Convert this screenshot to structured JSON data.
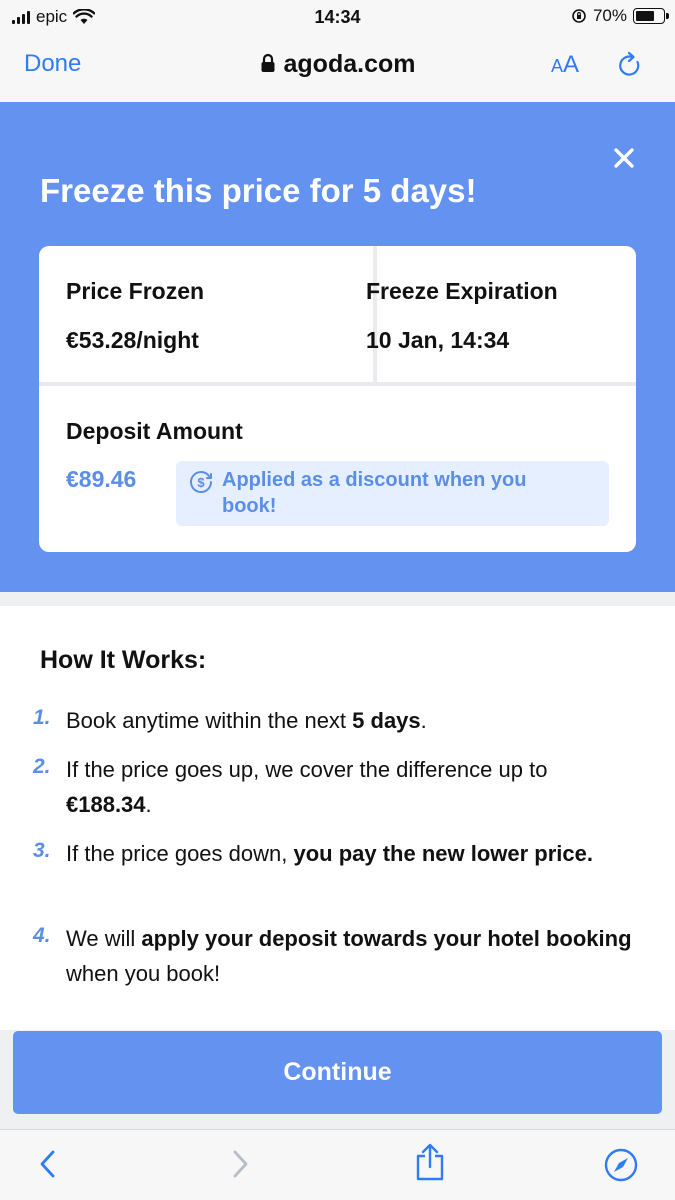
{
  "status_bar": {
    "carrier": "epic",
    "time": "14:34",
    "battery": "70%",
    "battery_level": 0.7
  },
  "nav": {
    "done_label": "Done",
    "url": "agoda.com",
    "aa_small": "A",
    "aa_large": "A"
  },
  "freeze": {
    "title": "Freeze this price for 5 days!",
    "price_frozen_label": "Price Frozen",
    "price_frozen_value": "€53.28/night",
    "expiration_label": "Freeze Expiration",
    "expiration_value": "10 Jan, 14:34",
    "deposit_label": "Deposit Amount",
    "deposit_value": "€89.46",
    "discount_line1": "Applied as a discount when you",
    "discount_line2": "book!"
  },
  "how": {
    "title": "How It Works:",
    "steps": [
      {
        "num": "1.",
        "a": "Book anytime within the next ",
        "b": "5 days",
        "c": "."
      },
      {
        "num": "2.",
        "a": "If the price goes up, we cover the difference up to ",
        "b": "€188.34",
        "c": "."
      },
      {
        "num": "3.",
        "a": "If the price goes down, ",
        "b": "you pay the new lower price.",
        "c": ""
      },
      {
        "num": "4.",
        "a": "We will ",
        "b": "apply your deposit towards your hotel booking",
        "c": " when you book!"
      }
    ]
  },
  "continue_label": "Continue",
  "colors": {
    "accent": "#2f7cf6",
    "panel": "#6492f0",
    "muted_blue": "#5b8ee6"
  },
  "toolbar_icons": [
    "back-icon",
    "forward-icon",
    "share-icon",
    "compass-icon"
  ]
}
